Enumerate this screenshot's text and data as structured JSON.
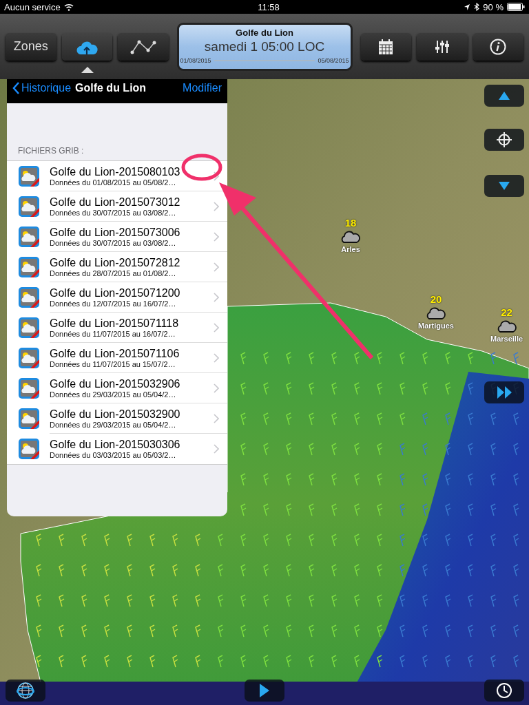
{
  "status_bar": {
    "carrier": "Aucun service",
    "time": "11:58",
    "battery": "90 %"
  },
  "toolbar": {
    "left_buttons": [
      {
        "kind": "text",
        "label": "Zones",
        "selected": false
      },
      {
        "kind": "cloud",
        "selected": true
      },
      {
        "kind": "route",
        "selected": false
      }
    ],
    "timeline": {
      "title": "Golfe du Lion",
      "time": "samedi 1 05:00 LOC",
      "start": "01/08/2015",
      "end": "05/08/2015"
    },
    "right_buttons": [
      {
        "kind": "calendar",
        "selected": false
      },
      {
        "kind": "sliders",
        "selected": false
      },
      {
        "kind": "info",
        "selected": false
      }
    ]
  },
  "panel": {
    "back": "Historique",
    "title": "Golfe du Lion",
    "edit": "Modifier",
    "section": "FICHIERS GRIB :",
    "rows": [
      {
        "title": "Golfe du Lion-2015080103",
        "subtitle": "Données du 01/08/2015 au 05/08/2…"
      },
      {
        "title": "Golfe du Lion-2015073012",
        "subtitle": "Données du 30/07/2015 au 03/08/2…"
      },
      {
        "title": "Golfe du Lion-2015073006",
        "subtitle": "Données du 30/07/2015 au 03/08/2…"
      },
      {
        "title": "Golfe du Lion-2015072812",
        "subtitle": "Données du 28/07/2015 au 01/08/2…"
      },
      {
        "title": "Golfe du Lion-2015071200",
        "subtitle": "Données du 12/07/2015 au 16/07/2…"
      },
      {
        "title": "Golfe du Lion-2015071118",
        "subtitle": "Données du 11/07/2015 au 16/07/2…"
      },
      {
        "title": "Golfe du Lion-2015071106",
        "subtitle": "Données du 11/07/2015 au 15/07/2…"
      },
      {
        "title": "Golfe du Lion-2015032906",
        "subtitle": "Données du 29/03/2015 au 05/04/2…"
      },
      {
        "title": "Golfe du Lion-2015032900",
        "subtitle": "Données du 29/03/2015 au 05/04/2…"
      },
      {
        "title": "Golfe du Lion-2015030306",
        "subtitle": "Données du 03/03/2015 au 05/03/2…"
      }
    ]
  },
  "map": {
    "places": [
      {
        "temperature": "18",
        "name": "Arles"
      },
      {
        "temperature": "20",
        "name": "Martigues"
      },
      {
        "temperature": "22",
        "name": "Marseille"
      }
    ]
  }
}
